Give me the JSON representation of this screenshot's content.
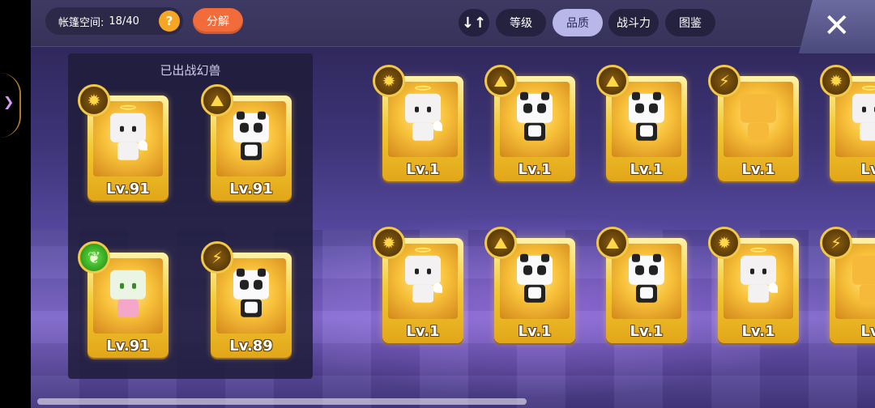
{
  "topbar": {
    "tent_label": "帐篷空间:",
    "tent_count": "18/40",
    "help_icon": "?",
    "decompose_label": "分解",
    "sort_icon": "↓↑",
    "tabs": [
      {
        "label": "等级"
      },
      {
        "label": "品质"
      },
      {
        "label": "战斗力"
      },
      {
        "label": "图鉴"
      }
    ],
    "close_icon": "✕"
  },
  "deployed_panel": {
    "title": "已出战幻兽",
    "cards": [
      {
        "level": "Lv.91",
        "badge": "sun",
        "pet": "angel-special"
      },
      {
        "level": "Lv.91",
        "badge": "mountain",
        "pet": "panda-special"
      },
      {
        "level": "Lv.91",
        "badge": "leaf",
        "pet": "flower-special"
      },
      {
        "level": "Lv.89",
        "badge": "lightning",
        "pet": "panda-hat"
      }
    ]
  },
  "grid": {
    "cards": [
      {
        "level": "Lv.1",
        "badge": "sun",
        "pet": "angel"
      },
      {
        "level": "Lv.1",
        "badge": "mountain",
        "pet": "panda"
      },
      {
        "level": "Lv.1",
        "badge": "mountain",
        "pet": "panda"
      },
      {
        "level": "Lv.1",
        "badge": "lightning",
        "pet": "mystery"
      },
      {
        "level": "Lv",
        "badge": "sun",
        "pet": "angel"
      },
      {
        "level": "Lv.1",
        "badge": "sun",
        "pet": "angel"
      },
      {
        "level": "Lv.1",
        "badge": "mountain",
        "pet": "panda"
      },
      {
        "level": "Lv.1",
        "badge": "mountain",
        "pet": "panda"
      },
      {
        "level": "Lv.1",
        "badge": "sun",
        "pet": "angel"
      },
      {
        "level": "Lv",
        "badge": "lightning",
        "pet": "mystery"
      }
    ]
  },
  "badge_icons": {
    "sun": "✹",
    "mountain": "⛰",
    "leaf": "❦",
    "lightning": "⚡"
  }
}
